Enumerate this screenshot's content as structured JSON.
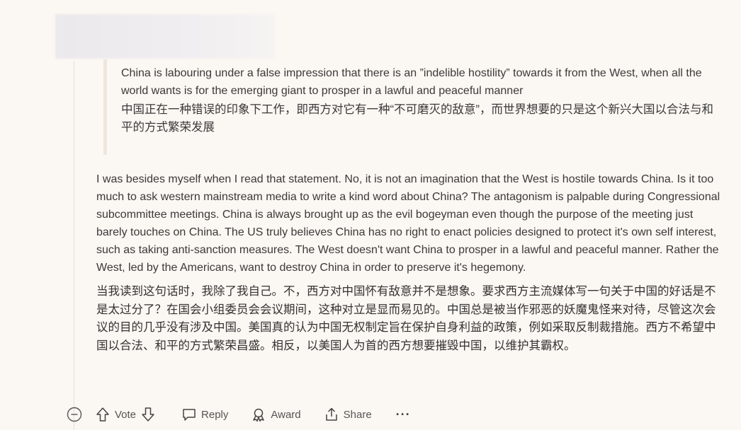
{
  "quote": {
    "en": "China is labouring under a false impression that there is an ”indelible hostility” towards it from the West, when all the world wants is for the emerging giant to prosper in a lawful and peaceful manner",
    "zh": "中国正在一种错误的印象下工作，即西方对它有一种“不可磨灭的敌意”，而世界想要的只是这个新兴大国以合法与和平的方式繁荣发展"
  },
  "comment": {
    "en": "I was besides myself when I read that statement. No, it is not an imagination that the West is hostile towards China. Is it too much to ask western mainstream media to write a kind word about China? The antagonism is palpable during Congressional subcommittee meetings. China is always brought up as the evil bogeyman even though the purpose of the meeting just barely touches on China. The US truly believes China has no right to enact policies designed to protect it's own self interest, such as taking anti-sanction measures. The West doesn't want China to prosper in a lawful and peaceful manner. Rather the West, led by the Americans, want to destroy China in order to preserve it's hegemony.",
    "zh": "当我读到这句话时，我除了我自己。不，西方对中国怀有敌意并不是想象。要求西方主流媒体写一句关于中国的好话是不是太过分了？在国会小组委员会会议期间，这种对立是显而易见的。中国总是被当作邪恶的妖魔鬼怪来对待，尽管这次会议的目的几乎没有涉及中国。美国真的认为中国无权制定旨在保护自身利益的政策，例如采取反制裁措施。西方不希望中国以合法、和平的方式繁荣昌盛。相反，以美国人为首的西方想要摧毁中国，以维护其霸权。"
  },
  "actions": {
    "collapse_icon": "collapse-minus-icon",
    "vote_label": "Vote",
    "reply_label": "Reply",
    "award_label": "Award",
    "share_label": "Share",
    "more_label": "···"
  }
}
